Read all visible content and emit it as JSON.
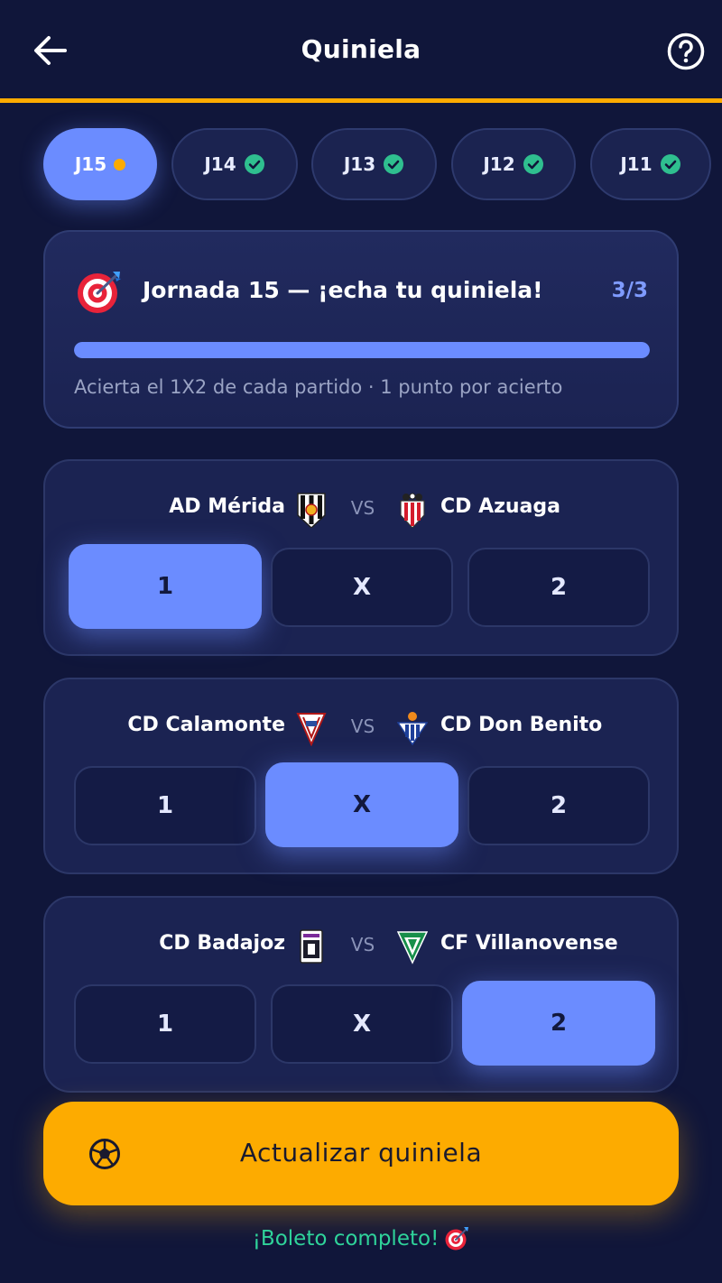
{
  "header": {
    "title": "Quiniela",
    "back_icon": "back-arrow-icon",
    "help_icon": "help-circle-icon"
  },
  "colors": {
    "background": "#10163a",
    "accent": "#6b8cff",
    "cta": "#fdab00",
    "success": "#2fd39a",
    "pending": "#fdab00"
  },
  "tabs": [
    {
      "label": "J15",
      "status": "pending",
      "active": true
    },
    {
      "label": "J14",
      "status": "done",
      "active": false
    },
    {
      "label": "J13",
      "status": "done",
      "active": false
    },
    {
      "label": "J12",
      "status": "done",
      "active": false
    },
    {
      "label": "J11",
      "status": "done",
      "active": false
    }
  ],
  "info": {
    "icon": "target-icon",
    "title": "Jornada 15 — ¡echa tu quiniela!",
    "count": "3/3",
    "progress": 1.0,
    "subtitle": "Acierta el 1X2 de cada partido · 1 punto por acierto"
  },
  "vs_label": "VS",
  "matches": [
    {
      "home": "AD Mérida",
      "away": "CD Azuaga",
      "options": [
        "1",
        "X",
        "2"
      ],
      "selected": "1"
    },
    {
      "home": "CD Calamonte",
      "away": "CD Don Benito",
      "options": [
        "1",
        "X",
        "2"
      ],
      "selected": "X"
    },
    {
      "home": "CD Badajoz",
      "away": "CF Villanovense",
      "options": [
        "1",
        "X",
        "2"
      ],
      "selected": "2"
    }
  ],
  "cta": {
    "label": "Actualizar quiniela",
    "icon": "soccer-ball-icon"
  },
  "footer": {
    "note": "¡Boleto completo!",
    "icon": "target-icon"
  }
}
